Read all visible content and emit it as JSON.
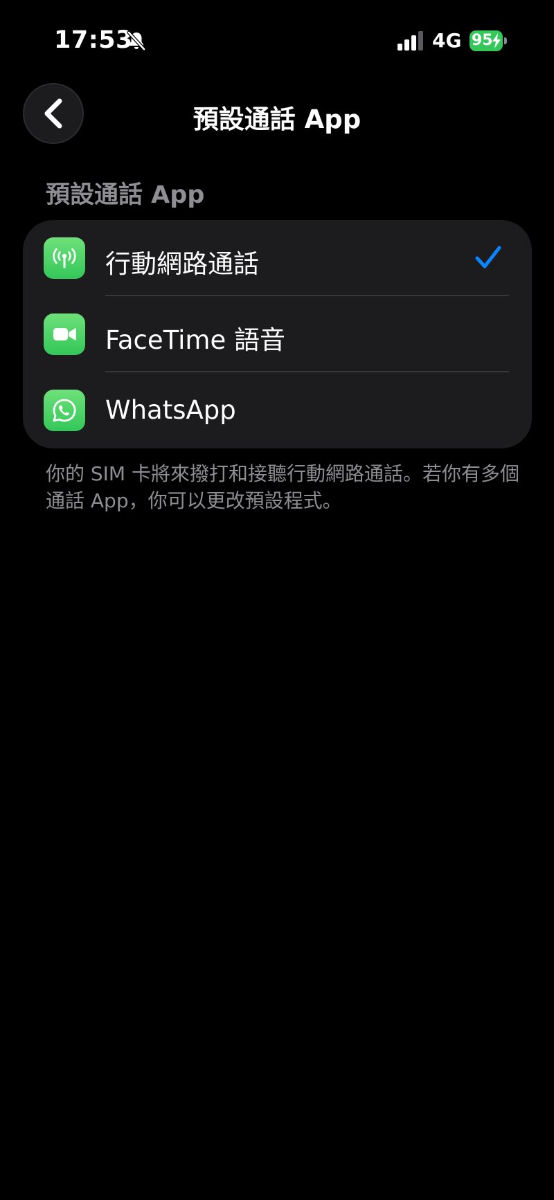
{
  "status_bar": {
    "time": "17:53",
    "silent_icon": "bell-slash-icon",
    "signal_icon": "cellular-signal-icon",
    "network": "4G",
    "battery_level": "95",
    "battery_charging": true
  },
  "nav": {
    "back_icon": "chevron-left-icon",
    "title": "預設通話 App"
  },
  "section": {
    "header": "預設通話 App",
    "items": [
      {
        "label": "行動網路通話",
        "icon": "cellular-antenna-icon",
        "selected": true
      },
      {
        "label": "FaceTime 語音",
        "icon": "facetime-camera-icon",
        "selected": false
      },
      {
        "label": "WhatsApp",
        "icon": "whatsapp-icon",
        "selected": false
      }
    ],
    "footer": "你的 SIM 卡將來撥打和接聽行動網路通話。若你有多個通話 App，你可以更改預設程式。"
  },
  "colors": {
    "background": "#000000",
    "card": "#1c1c1e",
    "accent": "#0a84ff",
    "secondary_text": "#8e8e93",
    "app_green": "#34c759"
  }
}
